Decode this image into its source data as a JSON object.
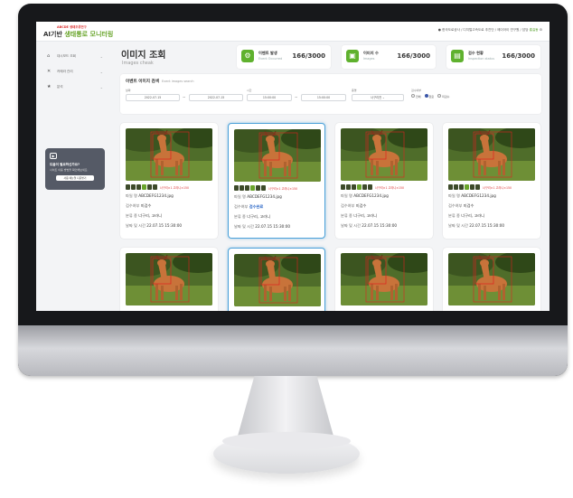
{
  "header": {
    "org_small": "ABCDE 생태조류연구",
    "logo_prefix": "AI기반 ",
    "logo_accent": "생태통로 모니터링",
    "user_text": "한국도로공사 / 디지털고속도로 추진단 / 에이아이 연구원 / 담당",
    "user_name": "홍길동"
  },
  "sidebar": {
    "items": [
      {
        "icon": "home-icon",
        "label": "대시보드 조회"
      },
      {
        "icon": "tool-icon",
        "label": "카메라 관리"
      },
      {
        "icon": "star-icon",
        "label": "분석"
      }
    ],
    "promo": {
      "title": "도움이 필요하신가요?",
      "text": "사이트 이용 방법을 확인해보세요.",
      "button": "사용 매뉴얼 다운받기"
    }
  },
  "page": {
    "title": "이미지 조회",
    "subtitle": "Images cheak"
  },
  "stats": [
    {
      "icon": "event-icon",
      "title": "이벤트 발생",
      "sub": "Event Occurred",
      "value": "166/3000"
    },
    {
      "icon": "image-icon",
      "title": "이미지 수",
      "sub": "Images",
      "value": "166/3000"
    },
    {
      "icon": "inspection-icon",
      "title": "검수 현황",
      "sub": "Inspection status",
      "value": "166/3000"
    }
  ],
  "filter": {
    "title": "이벤트 이미지 검색",
    "title_en": "Event images search",
    "date_label": "날짜",
    "date_from": "2022-07-15",
    "date_to": "2022-07-15",
    "time_label": "시간",
    "time_from": "15:00:00",
    "time_to": "15:00:00",
    "species_label": "종명",
    "species_value": "너구리전",
    "inspect_label": "검수여부",
    "radios": [
      "전체",
      "완료",
      "미검수"
    ],
    "radio_selected": 1
  },
  "cards": [
    {
      "tag": "너구리×1  고라니×150",
      "file_label": "파일 명",
      "file": "ABCDEFG1234.jpg",
      "inspect_label": "검수여부",
      "inspect": "미검수",
      "inspect_done": false,
      "class_label": "분류 종",
      "class": "너구리, 고라니",
      "time_label": "날짜 및 시간",
      "time": "22.07.15  15:30:00"
    },
    {
      "tag": "너구리×1  고라니×150",
      "file_label": "파일 명",
      "file": "ABCDEFG1234.jpg",
      "inspect_label": "검수여부",
      "inspect": "검수완료",
      "inspect_done": true,
      "class_label": "분류 종",
      "class": "너구리, 고라니",
      "time_label": "날짜 및 시간",
      "time": "22.07.15  15:30:00"
    },
    {
      "tag": "너구리×1  고라니×150",
      "file_label": "파일 명",
      "file": "ABCDEFG1234.jpg",
      "inspect_label": "검수여부",
      "inspect": "미검수",
      "inspect_done": false,
      "class_label": "분류 종",
      "class": "너구리, 고라니",
      "time_label": "날짜 및 시간",
      "time": "22.07.15  15:30:00"
    },
    {
      "tag": "너구리×1  고라니×150",
      "file_label": "파일 명",
      "file": "ABCDEFG1234.jpg",
      "inspect_label": "검수여부",
      "inspect": "미검수",
      "inspect_done": false,
      "class_label": "분류 종",
      "class": "너구리, 고라니",
      "time_label": "날짜 및 시간",
      "time": "22.07.15  15:30:00"
    }
  ],
  "colors": {
    "accent_green": "#5fb12e",
    "selection_blue": "#4aa0d8",
    "brand_red": "#dd3333"
  }
}
